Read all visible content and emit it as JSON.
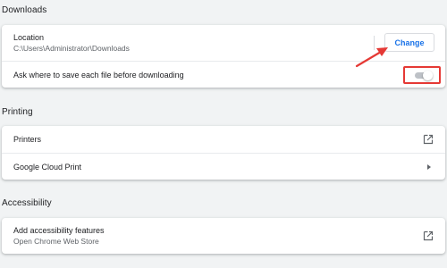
{
  "downloads": {
    "heading": "Downloads",
    "location_label": "Location",
    "location_path": "C:\\Users\\Administrator\\Downloads",
    "change_label": "Change",
    "ask_label": "Ask where to save each file before downloading",
    "ask_enabled": false
  },
  "printing": {
    "heading": "Printing",
    "printers_label": "Printers",
    "cloud_print_label": "Google Cloud Print"
  },
  "accessibility": {
    "heading": "Accessibility",
    "add_features_label": "Add accessibility features",
    "web_store_label": "Open Chrome Web Store"
  },
  "colors": {
    "accent": "#1a73e8",
    "annotation": "#e53935",
    "background": "#f1f3f4"
  },
  "icons": {
    "open_external": "open-in-new-icon",
    "submenu": "chevron-right-icon"
  }
}
